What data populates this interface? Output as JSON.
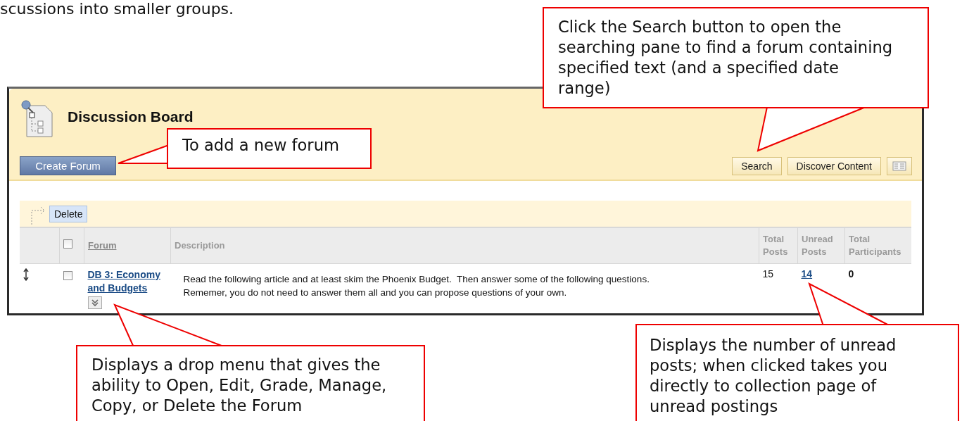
{
  "document_text": "scussions into smaller groups.",
  "board": {
    "title": "Discussion Board",
    "create_button": "Create Forum",
    "toolbar_buttons": [
      "Search",
      "Discover Content"
    ],
    "action_button": "Delete",
    "table": {
      "columns": [
        "Forum",
        "Description",
        "Total Posts",
        "Unread Posts",
        "Total Participants"
      ],
      "header_checked": false,
      "rows": [
        {
          "forum": "DB 3: Economy and Budgets",
          "description": "Read the following article and at least skim the Phoenix Budget.  Then answer some of the following questions.\nRememer, you do not need to answer them all and you can propose questions of your own.",
          "total_posts": "15",
          "unread_posts": "14",
          "total_participants": "0",
          "checked": false
        }
      ]
    }
  },
  "callouts": [
    {
      "text": "To add a new forum"
    },
    {
      "text": "Click the Search button to open the\nsearching pane to find a forum containing\nspecified text (and a specified date\nrange)"
    },
    {
      "text": "Displays a drop menu that gives the ability to Open, Edit, Grade, Manage, Copy, or Delete the Forum"
    },
    {
      "text": "Displays the number of unread\nposts; when clicked takes you\ndirectly to collection page of\nunread postings"
    }
  ]
}
